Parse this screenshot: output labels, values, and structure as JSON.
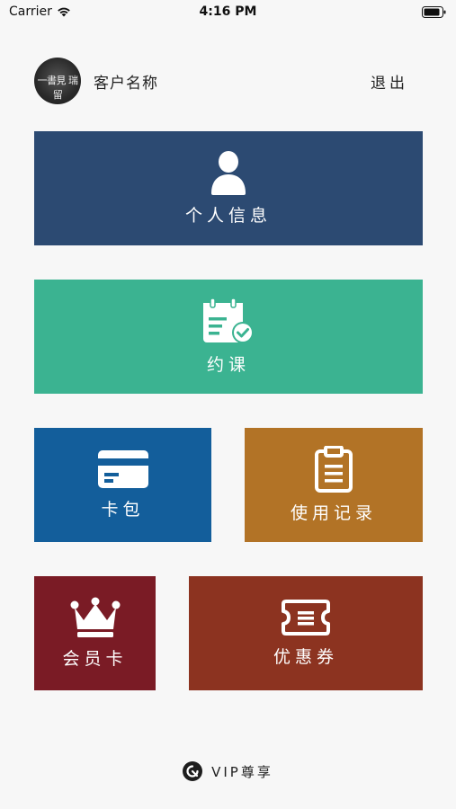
{
  "status_bar": {
    "carrier": "Carrier",
    "time": "4:16 PM"
  },
  "header": {
    "avatar_text": "一書見 瑞留",
    "customer_name": "客户名称",
    "logout_label": "退出"
  },
  "tiles": {
    "personal_info": {
      "label": "个人信息",
      "icon": "user-icon",
      "color": "#2c4a72"
    },
    "booking": {
      "label": "约课",
      "icon": "calendar-check-icon",
      "color": "#3bb391"
    },
    "card_wallet": {
      "label": "卡包",
      "icon": "credit-card-icon",
      "color": "#135e9b"
    },
    "usage_records": {
      "label": "使用记录",
      "icon": "clipboard-icon",
      "color": "#b27326"
    },
    "membership_card": {
      "label": "会员卡",
      "icon": "crown-icon",
      "color": "#7a1b25"
    },
    "coupons": {
      "label": "优惠券",
      "icon": "ticket-icon",
      "color": "#8c3320"
    }
  },
  "footer": {
    "brand": "VIP尊享",
    "logo_icon": "brand-logo-icon"
  }
}
